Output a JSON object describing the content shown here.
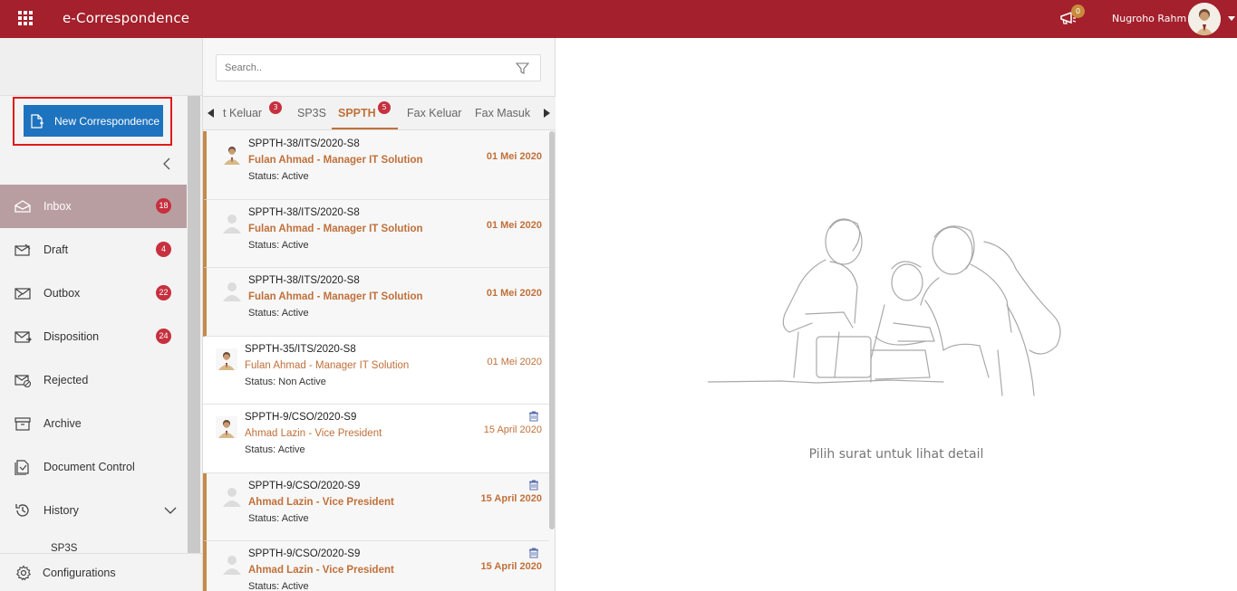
{
  "app": {
    "title": "e-Correspondence"
  },
  "header": {
    "notification_count": "0",
    "user_name": "Nugroho Rahm"
  },
  "sidebar": {
    "new_button_label": "New Correspondence",
    "items": [
      {
        "label": "Inbox",
        "badge": "18",
        "icon": "inbox-icon"
      },
      {
        "label": "Draft",
        "badge": "4",
        "icon": "draft-icon"
      },
      {
        "label": "Outbox",
        "badge": "22",
        "icon": "outbox-icon"
      },
      {
        "label": "Disposition",
        "badge": "24",
        "icon": "disposition-icon"
      },
      {
        "label": "Rejected",
        "badge": "",
        "icon": "rejected-icon"
      },
      {
        "label": "Archive",
        "badge": "",
        "icon": "archive-icon"
      },
      {
        "label": "Document Control",
        "badge": "",
        "icon": "document-control-icon"
      },
      {
        "label": "History",
        "badge": "",
        "icon": "history-icon"
      }
    ],
    "history_sub_item": "SP3S",
    "configurations_label": "Configurations"
  },
  "search": {
    "placeholder": "Search.."
  },
  "tabs": [
    {
      "label": "t Keluar",
      "badge": "3"
    },
    {
      "label": "SP3S",
      "badge": ""
    },
    {
      "label": "SPPTH",
      "badge": "5",
      "active": true
    },
    {
      "label": "Fax Keluar",
      "badge": ""
    },
    {
      "label": "Fax Masuk",
      "badge": ""
    }
  ],
  "list": [
    {
      "number": "SPPTH-38/ITS/2020-S8",
      "sender": "Fulan Ahmad - Manager IT Solution",
      "status": "Status: Active",
      "date": "01 Mei 2020",
      "unread": true,
      "avatar": "photo",
      "attachment": false
    },
    {
      "number": "SPPTH-38/ITS/2020-S8",
      "sender": "Fulan Ahmad - Manager IT Solution",
      "status": "Status: Active",
      "date": "01 Mei 2020",
      "unread": true,
      "avatar": "placeholder",
      "attachment": false
    },
    {
      "number": "SPPTH-38/ITS/2020-S8",
      "sender": "Fulan Ahmad - Manager IT Solution",
      "status": "Status: Active",
      "date": "01 Mei 2020",
      "unread": true,
      "avatar": "placeholder",
      "attachment": false
    },
    {
      "number": "SPPTH-35/ITS/2020-S8",
      "sender": "Fulan Ahmad - Manager IT Solution",
      "status": "Status: Non Active",
      "date": "01 Mei 2020",
      "unread": false,
      "avatar": "photo",
      "attachment": false
    },
    {
      "number": "SPPTH-9/CSO/2020-S9",
      "sender": "Ahmad Lazin - Vice President",
      "status": "Status: Active",
      "date": "15 April 2020",
      "unread": false,
      "avatar": "photo",
      "attachment": true
    },
    {
      "number": "SPPTH-9/CSO/2020-S9",
      "sender": "Ahmad Lazin - Vice President",
      "status": "Status: Active",
      "date": "15 April 2020",
      "unread": true,
      "avatar": "placeholder",
      "attachment": true
    },
    {
      "number": "SPPTH-9/CSO/2020-S9",
      "sender": "Ahmad Lazin - Vice President",
      "status": "Status: Active",
      "date": "15 April 2020",
      "unread": true,
      "avatar": "placeholder",
      "attachment": true
    }
  ],
  "detail": {
    "empty_message": "Pilih surat untuk lihat detail"
  },
  "colors": {
    "brand": "#a3202c",
    "primary_button": "#1e73be",
    "accent": "#c0703a",
    "badge": "#c6303f",
    "active_nav": "#b99ea1"
  }
}
